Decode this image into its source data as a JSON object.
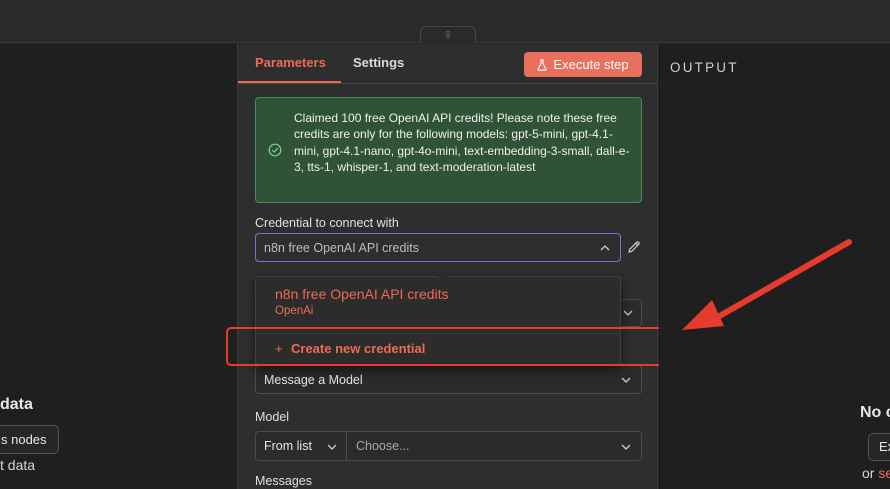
{
  "top": {
    "drag_handle_glyph": "⦙⦙"
  },
  "left_panel": {
    "title": "data",
    "button_label": "s nodes",
    "text": "t data"
  },
  "tabs": [
    {
      "label": "Parameters",
      "active": true
    },
    {
      "label": "Settings",
      "active": false
    }
  ],
  "execute_button": {
    "label": "Execute step",
    "icon": "flask-icon"
  },
  "notice": {
    "icon": "check-circle-icon",
    "text": "Claimed 100 free OpenAI API credits! Please note these free credits are only for the following models:   gpt-5-mini, gpt-4.1-mini, gpt-4.1-nano, gpt-4o-mini, text-embedding-3-small, dall-e-3, tts-1, whisper-1, and text-moderation-latest"
  },
  "credential": {
    "label": "Credential to connect with",
    "value": "n8n free OpenAI API credits",
    "edit_icon": "pencil-icon"
  },
  "dropdown": {
    "options": [
      {
        "title": "n8n free OpenAI API credits",
        "subtitle": "OpenAi"
      }
    ],
    "create_label": "Create new credential",
    "create_icon": "+"
  },
  "operation": {
    "value": "Message a Model"
  },
  "model": {
    "label": "Model",
    "mode": "From list",
    "placeholder": "Choose..."
  },
  "messages": {
    "label": "Messages"
  },
  "output": {
    "title": "OUTPUT",
    "heading": "No c",
    "button_label": "Ex",
    "or_prefix": "or ",
    "or_link": "se"
  },
  "colors": {
    "accent": "#ee6a55",
    "execute_bg": "#e8705d",
    "notice_bg": "#305236",
    "focus_border": "#7d6fe0",
    "annotation_red": "#e63b2e"
  }
}
